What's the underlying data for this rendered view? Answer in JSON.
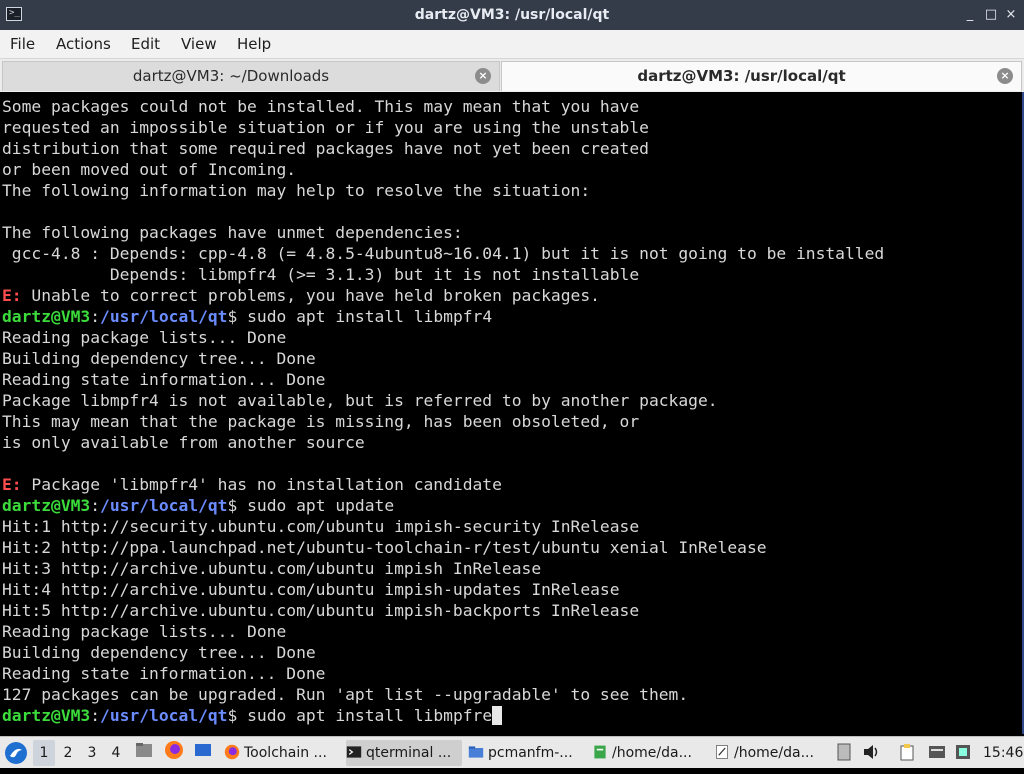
{
  "window": {
    "title": "dartz@VM3: /usr/local/qt",
    "icon_glyph": ">_",
    "controls": {
      "minimize": "_",
      "maximize": "□",
      "close": "×"
    }
  },
  "menu": [
    "File",
    "Actions",
    "Edit",
    "View",
    "Help"
  ],
  "tabs": [
    {
      "label": "dartz@VM3: ~/Downloads",
      "active": false
    },
    {
      "label": "dartz@VM3: /usr/local/qt",
      "active": true
    }
  ],
  "terminal": {
    "prompt": {
      "user_host": "dartz@VM3",
      "path": "/usr/local/qt",
      "symbol": "$"
    },
    "lines": [
      {
        "type": "text",
        "text": "Some packages could not be installed. This may mean that you have"
      },
      {
        "type": "text",
        "text": "requested an impossible situation or if you are using the unstable"
      },
      {
        "type": "text",
        "text": "distribution that some required packages have not yet been created"
      },
      {
        "type": "text",
        "text": "or been moved out of Incoming."
      },
      {
        "type": "text",
        "text": "The following information may help to resolve the situation:"
      },
      {
        "type": "text",
        "text": ""
      },
      {
        "type": "text",
        "text": "The following packages have unmet dependencies:"
      },
      {
        "type": "text",
        "text": " gcc-4.8 : Depends: cpp-4.8 (= 4.8.5-4ubuntu8~16.04.1) but it is not going to be installed"
      },
      {
        "type": "text",
        "text": "           Depends: libmpfr4 (>= 3.1.3) but it is not installable"
      },
      {
        "type": "error",
        "prefix": "E:",
        "text": " Unable to correct problems, you have held broken packages."
      },
      {
        "type": "prompt",
        "command": " sudo apt install libmpfr4"
      },
      {
        "type": "text",
        "text": "Reading package lists... Done"
      },
      {
        "type": "text",
        "text": "Building dependency tree... Done"
      },
      {
        "type": "text",
        "text": "Reading state information... Done"
      },
      {
        "type": "text",
        "text": "Package libmpfr4 is not available, but is referred to by another package."
      },
      {
        "type": "text",
        "text": "This may mean that the package is missing, has been obsoleted, or"
      },
      {
        "type": "text",
        "text": "is only available from another source"
      },
      {
        "type": "text",
        "text": ""
      },
      {
        "type": "error",
        "prefix": "E:",
        "text": " Package 'libmpfr4' has no installation candidate"
      },
      {
        "type": "prompt",
        "command": " sudo apt update"
      },
      {
        "type": "text",
        "text": "Hit:1 http://security.ubuntu.com/ubuntu impish-security InRelease"
      },
      {
        "type": "text",
        "text": "Hit:2 http://ppa.launchpad.net/ubuntu-toolchain-r/test/ubuntu xenial InRelease"
      },
      {
        "type": "text",
        "text": "Hit:3 http://archive.ubuntu.com/ubuntu impish InRelease"
      },
      {
        "type": "text",
        "text": "Hit:4 http://archive.ubuntu.com/ubuntu impish-updates InRelease"
      },
      {
        "type": "text",
        "text": "Hit:5 http://archive.ubuntu.com/ubuntu impish-backports InRelease"
      },
      {
        "type": "text",
        "text": "Reading package lists... Done"
      },
      {
        "type": "text",
        "text": "Building dependency tree... Done"
      },
      {
        "type": "text",
        "text": "Reading state information... Done"
      },
      {
        "type": "text",
        "text": "127 packages can be upgraded. Run 'apt list --upgradable' to see them."
      },
      {
        "type": "prompt",
        "command": " sudo apt install libmpfre",
        "cursor": true
      }
    ]
  },
  "taskbar": {
    "workspaces": [
      "1",
      "2",
      "3",
      "4"
    ],
    "active_workspace": "1",
    "tasks": [
      {
        "label": "Toolchain ...",
        "icon": "firefox-icon"
      },
      {
        "label": "qterminal ...",
        "icon": "terminal-icon",
        "active": true
      },
      {
        "label": "pcmanfm-...",
        "icon": "folder-icon"
      },
      {
        "label": "/home/da...",
        "icon": "file-icon"
      },
      {
        "label": "/home/da...",
        "icon": "text-editor-icon"
      }
    ],
    "clock": "15:46",
    "colors": {
      "accent": "#1f6fd1",
      "prompt_user": "#3bdb3b",
      "prompt_path": "#6b8cff",
      "error": "#ff4d4d"
    }
  }
}
